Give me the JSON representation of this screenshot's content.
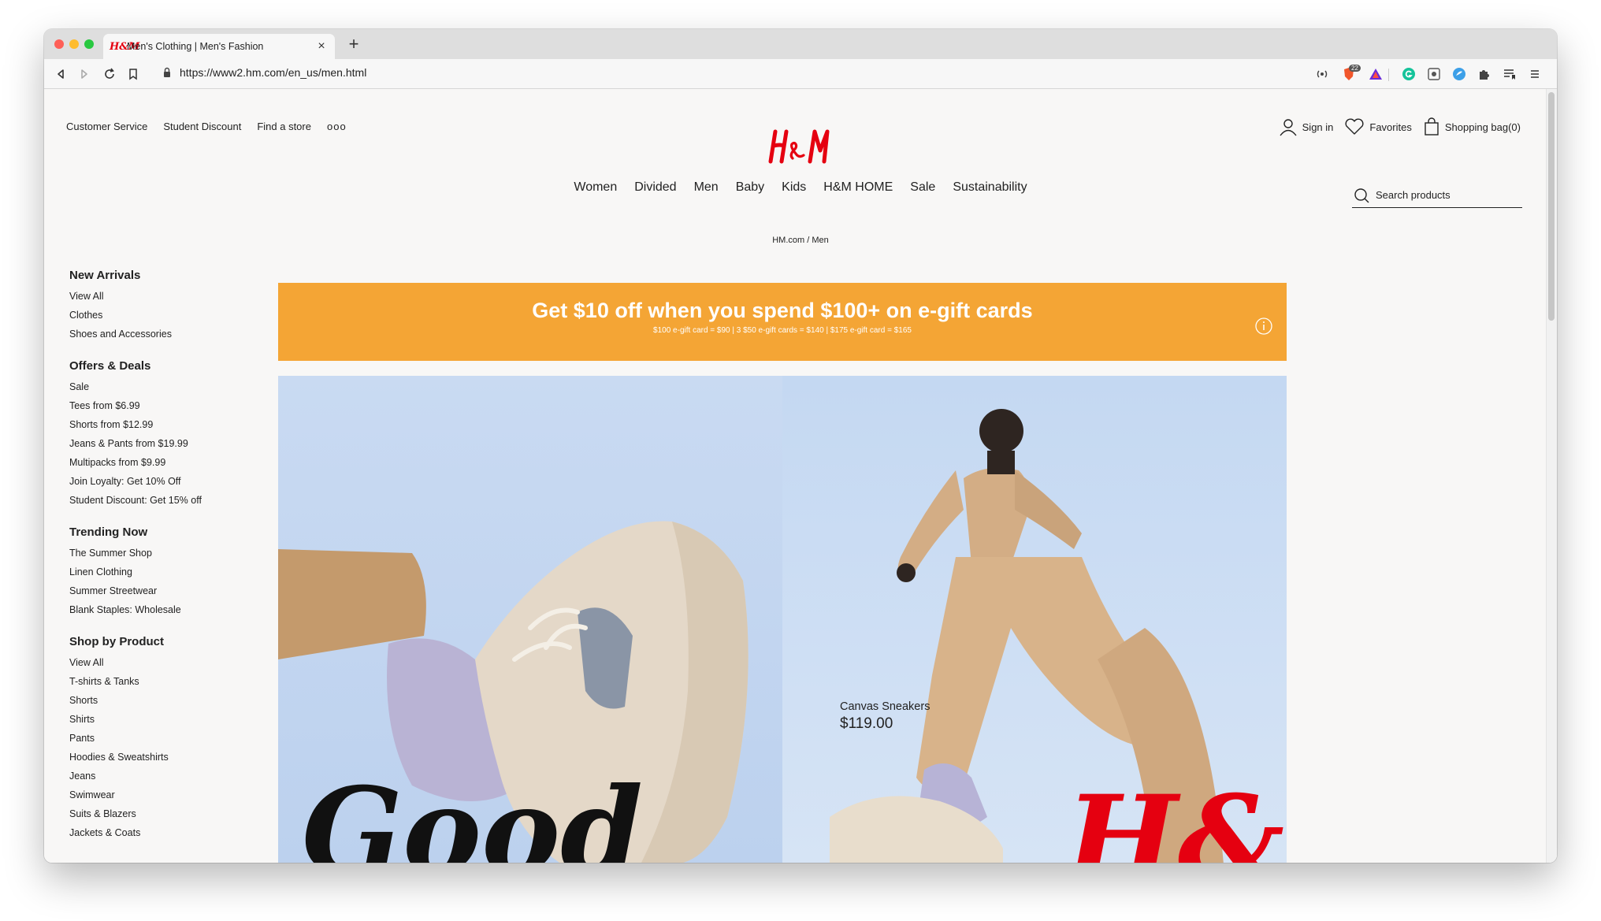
{
  "browser": {
    "tab_title": "Men's Clothing | Men's Fashion",
    "url": "https://www2.hm.com/en_us/men.html",
    "badge_count": "22"
  },
  "site": {
    "brand_color": "#e50010",
    "utility_links": [
      "Customer Service",
      "Student Discount",
      "Find a store",
      "ooo"
    ],
    "account": {
      "sign_in": "Sign in",
      "favorites": "Favorites",
      "shopping_bag": "Shopping bag(0)"
    },
    "main_nav": [
      "Women",
      "Divided",
      "Men",
      "Baby",
      "Kids",
      "H&M HOME",
      "Sale",
      "Sustainability"
    ],
    "search_placeholder": "Search products",
    "breadcrumb": "HM.com / Men"
  },
  "sidebar": [
    {
      "title": "New Arrivals",
      "links": [
        "View All",
        "Clothes",
        "Shoes and Accessories"
      ]
    },
    {
      "title": "Offers & Deals",
      "links": [
        "Sale",
        "Tees from $6.99",
        "Shorts from $12.99",
        "Jeans & Pants from $19.99",
        "Multipacks from $9.99",
        "Join Loyalty: Get 10% Off",
        "Student Discount: Get 15% off"
      ]
    },
    {
      "title": "Trending Now",
      "links": [
        "The Summer Shop",
        "Linen Clothing",
        "Summer Streetwear",
        "Blank Staples: Wholesale"
      ]
    },
    {
      "title": "Shop by Product",
      "links": [
        "View All",
        "T-shirts & Tanks",
        "Shorts",
        "Shirts",
        "Pants",
        "Hoodies & Sweatshirts",
        "Jeans",
        "Swimwear",
        "Suits & Blazers",
        "Jackets & Coats"
      ]
    }
  ],
  "banner": {
    "headline": "Get $10 off when you spend $100+ on e-gift cards",
    "subline": "$100 e-gift card = $90 | 3 $50 e-gift cards = $140 | $175 e-gift card = $165",
    "color": "#f4a535"
  },
  "hero": {
    "product_name": "Canvas Sneakers",
    "product_price": "$119.00",
    "overlay_text": "Good",
    "overlay_logo": "H&M"
  }
}
